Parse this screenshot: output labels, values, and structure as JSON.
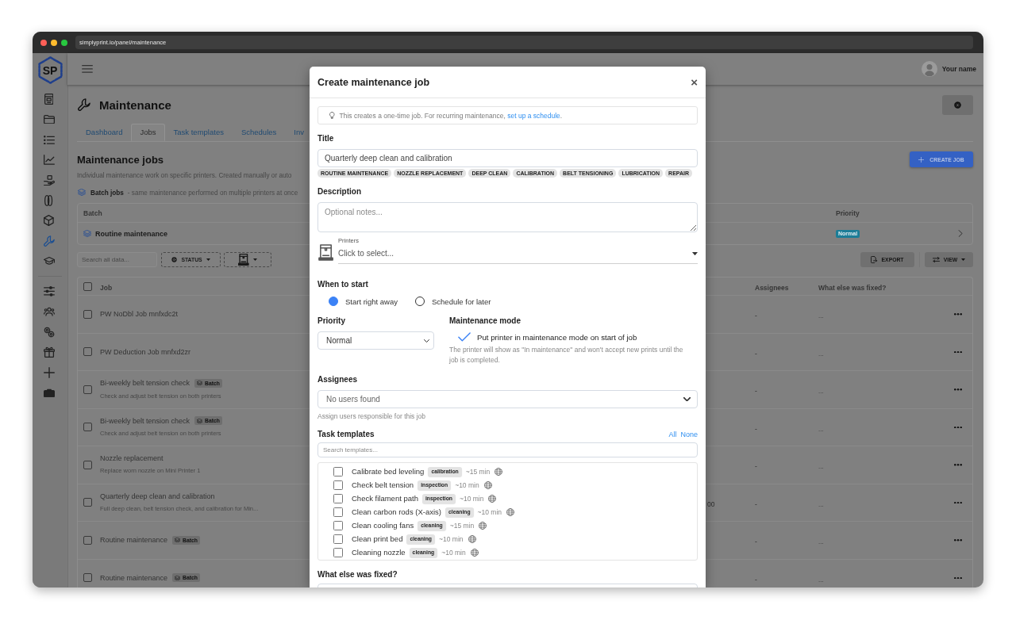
{
  "browser": {
    "url": "simplyprint.io/panel/maintenance"
  },
  "sidebar": {
    "logo": "SP",
    "top_items": [
      {
        "selected": false
      },
      {
        "selected": false
      },
      {
        "selected": false
      },
      {
        "selected": false
      },
      {
        "selected": false
      },
      {
        "selected": false
      },
      {
        "selected": false
      },
      {
        "selected": true
      },
      {
        "selected": false
      }
    ],
    "bottom_items": [
      {
        "selected": false
      },
      {
        "selected": false
      },
      {
        "selected": false
      },
      {
        "selected": false
      },
      {
        "selected": false
      },
      {
        "selected": false
      }
    ]
  },
  "topbar": {
    "user_name": "Your name"
  },
  "page": {
    "title": "Maintenance",
    "tabs": [
      {
        "label": "Dashboard",
        "selected": false
      },
      {
        "label": "Jobs",
        "selected": true
      },
      {
        "label": "Task templates",
        "selected": false
      },
      {
        "label": "Schedules",
        "selected": false
      },
      {
        "label": "Inv",
        "selected": false
      }
    ]
  },
  "jobs_section": {
    "title": "Maintenance jobs",
    "description": "Individual maintenance work on specific printers. Created manually or auto",
    "create_button": "CREATE JOB",
    "batch_label": "Batch jobs",
    "batch_note": "- same maintenance performed on multiple printers at once"
  },
  "batch_table": {
    "columns": [
      "Batch",
      "Priority"
    ],
    "rows": [
      {
        "name": "Routine maintenance",
        "priority": "Normal"
      }
    ]
  },
  "toolbar": {
    "search": {
      "placeholder": "Search all data..."
    },
    "status_filter": "STATUS",
    "export_button": "EXPORT",
    "view_button": "VIEW"
  },
  "jobs_table": {
    "select_all_checked": false,
    "columns": [
      "Job",
      "Assignees",
      "What else was fixed?"
    ],
    "rows": [
      {
        "checked": false,
        "title": "PW NoDbl Job mnfxdc2t",
        "assignees": "-",
        "fixed": "..."
      },
      {
        "checked": false,
        "title": "PW Deduction Job mnfxd2zr",
        "assignees": "-",
        "fixed": "..."
      },
      {
        "checked": false,
        "title": "Bi-weekly belt tension check",
        "badge": "Batch",
        "subtitle": "Check and adjust belt tension on both printers",
        "assignees": "-",
        "fixed": "..."
      },
      {
        "checked": false,
        "title": "Bi-weekly belt tension check",
        "badge": "Batch",
        "subtitle": "Check and adjust belt tension on both printers",
        "assignees": "-",
        "fixed": "..."
      },
      {
        "checked": false,
        "title": "Nozzle replacement",
        "subtitle": "Replace worn nozzle on Mini Printer 1",
        "assignees": "-",
        "fixed": "..."
      },
      {
        "checked": false,
        "title": "Quarterly deep clean and calibration",
        "subtitle": "Full deep clean, belt tension check, and calibration for Min...",
        "column_3": "00",
        "assignees": "-",
        "fixed": "..."
      },
      {
        "checked": false,
        "title": "Routine maintenance",
        "badge": "Batch",
        "assignees": "-",
        "fixed": "..."
      },
      {
        "checked": false,
        "title": "Routine maintenance",
        "badge": "Batch",
        "assignees": "-",
        "fixed": "..."
      }
    ]
  },
  "modal": {
    "title": "Create maintenance job",
    "close": "×",
    "info": {
      "before": "This creates a one-time job. For recurring maintenance,",
      "link": "set up a schedule",
      "after": "."
    },
    "title_field": {
      "label": "Title",
      "value": "Quarterly deep clean and calibration",
      "suggestions": [
        "ROUTINE MAINTENANCE",
        "NOZZLE REPLACEMENT",
        "DEEP CLEAN",
        "CALIBRATION",
        "BELT TENSIONING",
        "LUBRICATION",
        "REPAIR"
      ]
    },
    "description_field": {
      "label": "Description",
      "placeholder": "Optional notes..."
    },
    "printers_field": {
      "label": "Printers",
      "placeholder": "Click to select..."
    },
    "when_to_start": {
      "label": "When to start",
      "options": [
        {
          "label": "Start right away",
          "selected": true
        },
        {
          "label": "Schedule for later",
          "selected": false
        }
      ]
    },
    "priority": {
      "label": "Priority",
      "value": "Normal"
    },
    "maintenance_mode": {
      "label": "Maintenance mode",
      "option": "Put printer in maintenance mode on start of job",
      "checked": true,
      "help": "The printer will show as \"In maintenance\" and won't accept new prints until the job is completed."
    },
    "assignees": {
      "label": "Assignees",
      "placeholder": "No users found",
      "help": "Assign users responsible for this job"
    },
    "task_templates": {
      "label": "Task templates",
      "select_all": "All",
      "select_none": "None",
      "search": {
        "placeholder": "Search templates..."
      },
      "items": [
        {
          "name": "Calibrate bed leveling",
          "category": "calibration",
          "duration": "~15 min",
          "checked": false
        },
        {
          "name": "Check belt tension",
          "category": "inspection",
          "duration": "~10 min",
          "checked": false
        },
        {
          "name": "Check filament path",
          "category": "inspection",
          "duration": "~10 min",
          "checked": false
        },
        {
          "name": "Clean carbon rods (X-axis)",
          "category": "cleaning",
          "duration": "~10 min",
          "checked": false
        },
        {
          "name": "Clean cooling fans",
          "category": "cleaning",
          "duration": "~15 min",
          "checked": false
        },
        {
          "name": "Clean print bed",
          "category": "cleaning",
          "duration": "~10 min",
          "checked": false
        },
        {
          "name": "Cleaning nozzle",
          "category": "cleaning",
          "duration": "~10 min",
          "checked": false
        }
      ]
    },
    "fixed_field": {
      "label": "What else was fixed?"
    }
  }
}
